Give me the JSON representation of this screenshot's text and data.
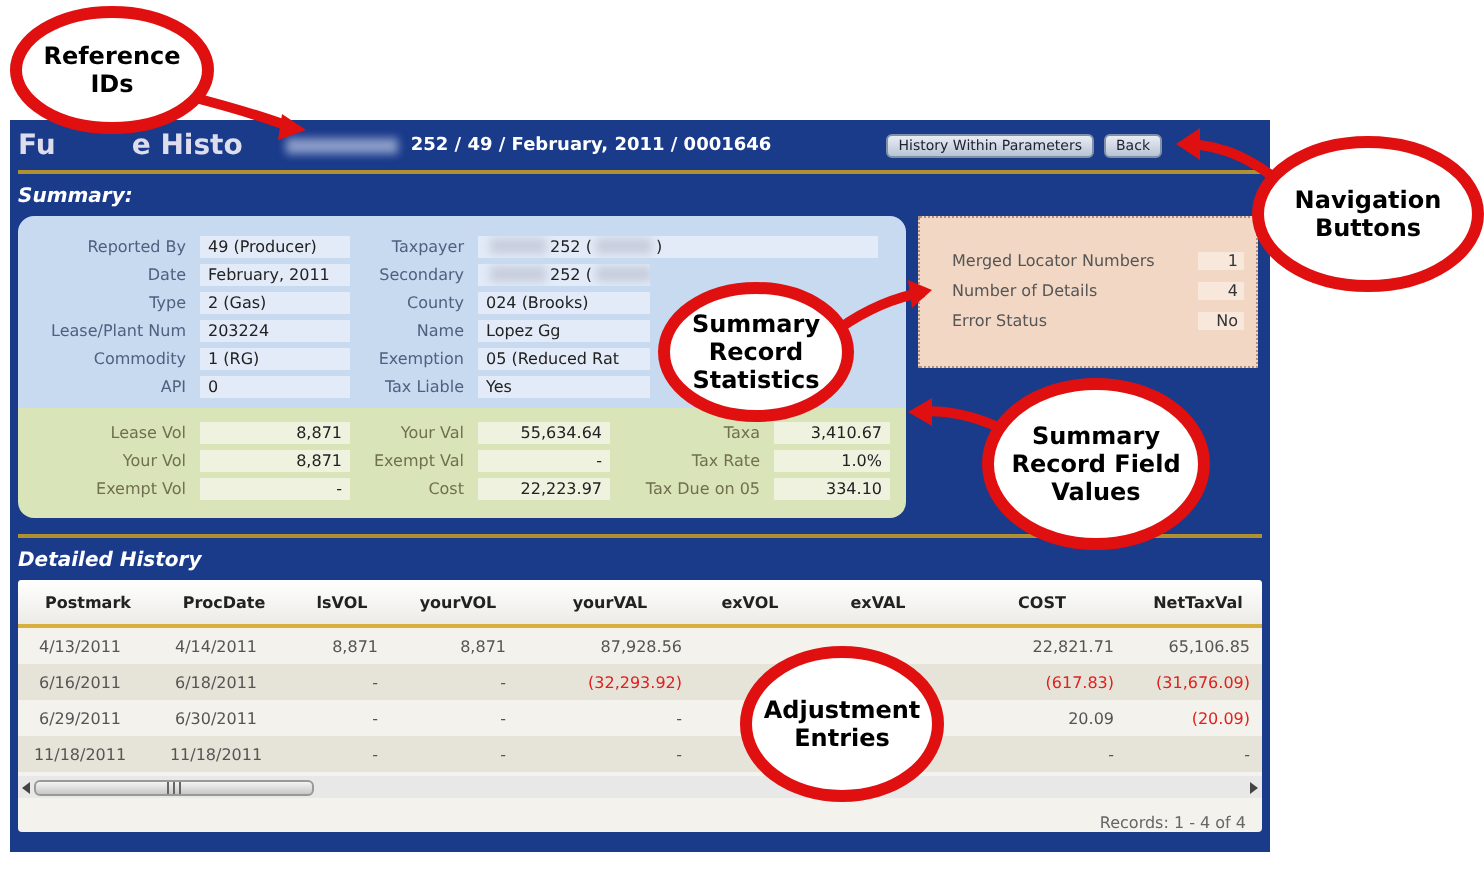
{
  "header": {
    "title_parts": [
      "Fu",
      "e Histo"
    ],
    "reference": [
      {
        "kind": "blur"
      },
      {
        "kind": "text",
        "text": "252 / 49 / February, 2011 / 0001646"
      }
    ],
    "buttons": [
      "History Within Parameters",
      "Back"
    ]
  },
  "summary": {
    "heading": "Summary:",
    "info_rows": [
      {
        "label": "Reported By",
        "value": [
          {
            "kind": "text",
            "text": "49 (Producer)"
          }
        ],
        "label_2": "Taxpayer",
        "value_2": [
          {
            "kind": "blur"
          },
          {
            "kind": "text",
            "text": "252 ("
          },
          {
            "kind": "blur"
          },
          {
            "kind": "text",
            "text": ")"
          }
        ]
      },
      {
        "label": "Date",
        "value": [
          {
            "kind": "text",
            "text": "February, 2011"
          }
        ],
        "label_2": "Secondary",
        "value_2": [
          {
            "kind": "blur"
          },
          {
            "kind": "text",
            "text": "252 ("
          },
          {
            "kind": "blur"
          }
        ]
      },
      {
        "label": "Type",
        "value": [
          {
            "kind": "text",
            "text": "2 (Gas)"
          }
        ],
        "label_2": "County",
        "value_2": [
          {
            "kind": "text",
            "text": "024 (Brooks)"
          }
        ]
      },
      {
        "label": "Lease/Plant Num",
        "value": [
          {
            "kind": "text",
            "text": "203224"
          }
        ],
        "label_2": "Name",
        "value_2": [
          {
            "kind": "text",
            "text": "Lopez Gg"
          }
        ]
      },
      {
        "label": "Commodity",
        "value": [
          {
            "kind": "text",
            "text": "1 (RG)"
          }
        ],
        "label_2": "Exemption",
        "value_2": [
          {
            "kind": "text",
            "text": "05 (Reduced Rat"
          }
        ]
      },
      {
        "label": "API",
        "value": [
          {
            "kind": "text",
            "text": "0"
          }
        ],
        "label_2": "Tax Liable",
        "value_2": [
          {
            "kind": "text",
            "text": "Yes"
          }
        ]
      }
    ],
    "value_rows": [
      [
        {
          "label": "Lease Vol",
          "value": "8,871"
        },
        {
          "label": "Your Val",
          "value": "55,634.64"
        },
        {
          "label": "Taxa",
          "value": "3,410.67"
        }
      ],
      [
        {
          "label": "Your Vol",
          "value": "8,871"
        },
        {
          "label": "Exempt Val",
          "value": "-"
        },
        {
          "label": "Tax Rate",
          "value": "1.0%"
        }
      ],
      [
        {
          "label": "Exempt Vol",
          "value": "-"
        },
        {
          "label": "Cost",
          "value": "22,223.97"
        },
        {
          "label": "Tax Due on 05",
          "value": "334.10"
        }
      ]
    ],
    "statistics": [
      {
        "label": "Merged Locator Numbers",
        "value": "1"
      },
      {
        "label": "Number of Details",
        "value": "4"
      },
      {
        "label": "Error Status",
        "value": "No"
      }
    ]
  },
  "detailed_history": {
    "heading": "Detailed History",
    "columns": [
      "Postmark",
      "ProcDate",
      "lsVOL",
      "yourVOL",
      "yourVAL",
      "exVOL",
      "exVAL",
      "COST",
      "NetTaxVal"
    ],
    "rows": [
      [
        {
          "text": "4/13/2011",
          "negative": false
        },
        {
          "text": "4/14/2011",
          "negative": false
        },
        {
          "text": "8,871",
          "negative": false
        },
        {
          "text": "8,871",
          "negative": false
        },
        {
          "text": "87,928.56",
          "negative": false
        },
        null,
        null,
        {
          "text": "22,821.71",
          "negative": false
        },
        {
          "text": "65,106.85",
          "negative": false
        }
      ],
      [
        {
          "text": "6/16/2011",
          "negative": false
        },
        {
          "text": "6/18/2011",
          "negative": false
        },
        {
          "text": "-",
          "negative": false
        },
        {
          "text": "-",
          "negative": false
        },
        {
          "text": "(32,293.92)",
          "negative": true
        },
        null,
        null,
        {
          "text": "(617.83)",
          "negative": true
        },
        {
          "text": "(31,676.09)",
          "negative": true
        }
      ],
      [
        {
          "text": "6/29/2011",
          "negative": false
        },
        {
          "text": "6/30/2011",
          "negative": false
        },
        {
          "text": "-",
          "negative": false
        },
        {
          "text": "-",
          "negative": false
        },
        {
          "text": "-",
          "negative": false
        },
        null,
        null,
        {
          "text": "20.09",
          "negative": false
        },
        {
          "text": "(20.09)",
          "negative": true
        }
      ],
      [
        {
          "text": "11/18/2011",
          "negative": false
        },
        {
          "text": "11/18/2011",
          "negative": false
        },
        {
          "text": "-",
          "negative": false
        },
        {
          "text": "-",
          "negative": false
        },
        {
          "text": "-",
          "negative": false
        },
        null,
        null,
        {
          "text": "-",
          "negative": false
        },
        {
          "text": "-",
          "negative": false
        }
      ]
    ],
    "records": "Records: 1 - 4 of 4"
  },
  "callouts": [
    {
      "lines": [
        "Reference",
        "IDs"
      ]
    },
    {
      "lines": [
        "Navigation",
        "Buttons"
      ]
    },
    {
      "lines": [
        "Summary",
        "Record",
        "Statistics"
      ]
    },
    {
      "lines": [
        "Summary",
        "Record Field",
        "Values"
      ]
    },
    {
      "lines": [
        "Adjustment",
        "Entries"
      ]
    }
  ]
}
